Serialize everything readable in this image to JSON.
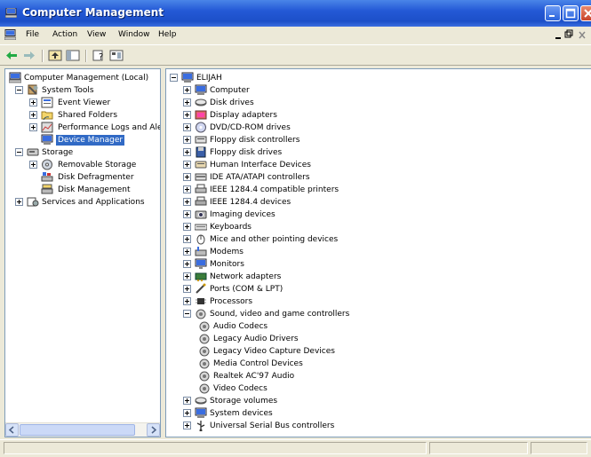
{
  "window": {
    "title": "Computer Management"
  },
  "menu": [
    "File",
    "Action",
    "View",
    "Window",
    "Help"
  ],
  "left_tree": [
    {
      "label": "Computer Management (Local)",
      "icon": "computer-management-icon"
    },
    {
      "label": "System Tools",
      "icon": "system-tools-icon"
    },
    {
      "label": "Event Viewer",
      "icon": "event-viewer-icon"
    },
    {
      "label": "Shared Folders",
      "icon": "shared-folders-icon"
    },
    {
      "label": "Performance Logs and Alerts",
      "icon": "performance-logs-icon"
    },
    {
      "label": "Device Manager",
      "icon": "device-manager-icon",
      "selected": true
    },
    {
      "label": "Storage",
      "icon": "storage-icon"
    },
    {
      "label": "Removable Storage",
      "icon": "removable-storage-icon"
    },
    {
      "label": "Disk Defragmenter",
      "icon": "disk-defragmenter-icon"
    },
    {
      "label": "Disk Management",
      "icon": "disk-management-icon"
    },
    {
      "label": "Services and Applications",
      "icon": "services-applications-icon"
    }
  ],
  "device_tree": [
    {
      "label": "ELIJAH",
      "icon": "computer-icon"
    },
    {
      "label": "Computer",
      "icon": "computer-icon"
    },
    {
      "label": "Disk drives",
      "icon": "disk-drive-icon"
    },
    {
      "label": "Display adapters",
      "icon": "display-adapter-icon"
    },
    {
      "label": "DVD/CD-ROM drives",
      "icon": "dvd-drive-icon"
    },
    {
      "label": "Floppy disk controllers",
      "icon": "floppy-controller-icon"
    },
    {
      "label": "Floppy disk drives",
      "icon": "floppy-drive-icon"
    },
    {
      "label": "Human Interface Devices",
      "icon": "hid-icon"
    },
    {
      "label": "IDE ATA/ATAPI controllers",
      "icon": "ide-controller-icon"
    },
    {
      "label": "IEEE 1284.4 compatible printers",
      "icon": "printer-icon"
    },
    {
      "label": "IEEE 1284.4 devices",
      "icon": "ieee-device-icon"
    },
    {
      "label": "Imaging devices",
      "icon": "imaging-device-icon"
    },
    {
      "label": "Keyboards",
      "icon": "keyboard-icon"
    },
    {
      "label": "Mice and other pointing devices",
      "icon": "mouse-icon"
    },
    {
      "label": "Modems",
      "icon": "modem-icon"
    },
    {
      "label": "Monitors",
      "icon": "monitor-icon"
    },
    {
      "label": "Network adapters",
      "icon": "network-adapter-icon"
    },
    {
      "label": "Ports (COM & LPT)",
      "icon": "port-icon"
    },
    {
      "label": "Processors",
      "icon": "processor-icon"
    },
    {
      "label": "Sound, video and game controllers",
      "icon": "sound-icon"
    },
    {
      "label": "Audio Codecs",
      "icon": "sound-icon"
    },
    {
      "label": "Legacy Audio Drivers",
      "icon": "sound-icon"
    },
    {
      "label": "Legacy Video Capture Devices",
      "icon": "sound-icon"
    },
    {
      "label": "Media Control Devices",
      "icon": "sound-icon"
    },
    {
      "label": "Realtek AC'97 Audio",
      "icon": "sound-icon"
    },
    {
      "label": "Video Codecs",
      "icon": "sound-icon"
    },
    {
      "label": "Storage volumes",
      "icon": "disk-drive-icon"
    },
    {
      "label": "System devices",
      "icon": "computer-icon"
    },
    {
      "label": "Universal Serial Bus controllers",
      "icon": "usb-icon"
    }
  ]
}
